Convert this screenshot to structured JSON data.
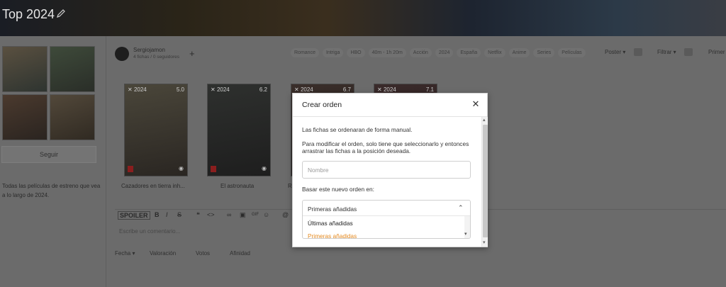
{
  "banner": {
    "title": "Top 2024"
  },
  "sidebar": {
    "follow_label": "Seguir",
    "description": "Todas las películas de estreno que vea a lo largo de 2024."
  },
  "user": {
    "name": "Sergiojamon",
    "stats": "4 fichas / 0 seguidores"
  },
  "tags": [
    "Romance",
    "Intriga",
    "HBO",
    "40m - 1h 20m",
    "Acción",
    "2024",
    "España",
    "Netflix",
    "Anime",
    "Series",
    "Películas"
  ],
  "controls": {
    "view": "Poster",
    "filter": "Filtrar",
    "first": "Primer"
  },
  "posters": [
    {
      "year": "2024",
      "score": "5.0",
      "title": "Cazadores en tierra inh..."
    },
    {
      "year": "2024",
      "score": "6.2",
      "title": "El astronauta"
    },
    {
      "year": "2024",
      "score": "6.7",
      "title": "R..."
    },
    {
      "year": "2024",
      "score": "7.1",
      "title": ""
    }
  ],
  "editor": {
    "spoiler": "SPOILER",
    "placeholder": "Escribe un comentario..."
  },
  "sort": {
    "items": [
      "Fecha",
      "Valoración",
      "Votos",
      "Afinidad"
    ]
  },
  "modal": {
    "title": "Crear orden",
    "info1": "Las fichas se ordenaran de forma manual.",
    "info2": "Para modificar el orden, solo tiene que seleccionarlo y entonces arrastrar las fichas a la posición deseada.",
    "name_placeholder": "Nombre",
    "base_label": "Basar este nuevo orden en:",
    "select": {
      "selected": "Primeras añadidas",
      "options": [
        "Últimas añadidas",
        "Primeras añadidas"
      ]
    }
  },
  "colors": {
    "accent": "#e58a1f",
    "overlay": "#5c5c5c"
  }
}
